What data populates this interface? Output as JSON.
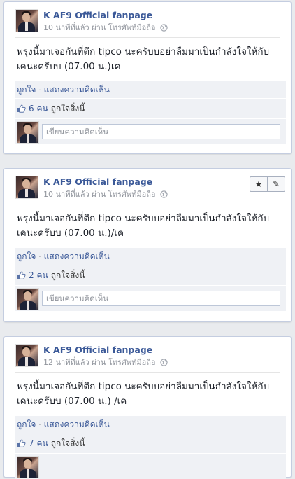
{
  "posts": [
    {
      "page_name": "K AF9 Official fanpage",
      "meta": "10 นาทีที่แล้ว ผ่าน โทรศัพท์มือถือ",
      "text": "พรุ่งนี้มาเจอกันที่ตึก tipco นะครับบอย่าลืมมาเป็นกำลังใจให้กับเคนะครับบ (07.00 น.)เค",
      "like_action": "ถูกใจ",
      "comment_action": "แสดงความคิดเห็น",
      "likes_count": "6 คน",
      "likes_suffix": "ถูกใจสิ่งนี้",
      "comment_placeholder": "เขียนความคิดเห็น"
    },
    {
      "page_name": "K AF9 Official fanpage",
      "meta": "10 นาทีที่แล้ว ผ่าน โทรศัพท์มือถือ",
      "text": "พรุ่งนี้มาเจอกันที่ตึก tipco นะครับบอย่าลืมมาเป็นกำลังใจให้กับเคนะครับบ (07.00 น.)/เค",
      "like_action": "ถูกใจ",
      "comment_action": "แสดงความคิดเห็น",
      "likes_count": "2 คน",
      "likes_suffix": "ถูกใจสิ่งนี้",
      "comment_placeholder": "เขียนความคิดเห็น"
    },
    {
      "page_name": "K AF9 Official fanpage",
      "meta": "12 นาทีที่แล้ว ผ่าน โทรศัพท์มือถือ",
      "text": "พรุ่งนี้มาเจอกันที่ตึก tipco นะครับบอย่าลืมมาเป็นกำลังใจให้กับเคนะครับบ (07.00 น.) /เค",
      "like_action": "ถูกใจ",
      "comment_action": "แสดงความคิดเห็น",
      "likes_count": "7 คน",
      "likes_suffix": "ถูกใจสิ่งนี้",
      "comment_placeholder": ""
    }
  ],
  "tools": {
    "star_icon": "★",
    "pencil_icon": "✎"
  },
  "colors": {
    "link": "#3b5998",
    "ufi_bg": "#eff1f5",
    "page_bg": "#e9ebee"
  }
}
